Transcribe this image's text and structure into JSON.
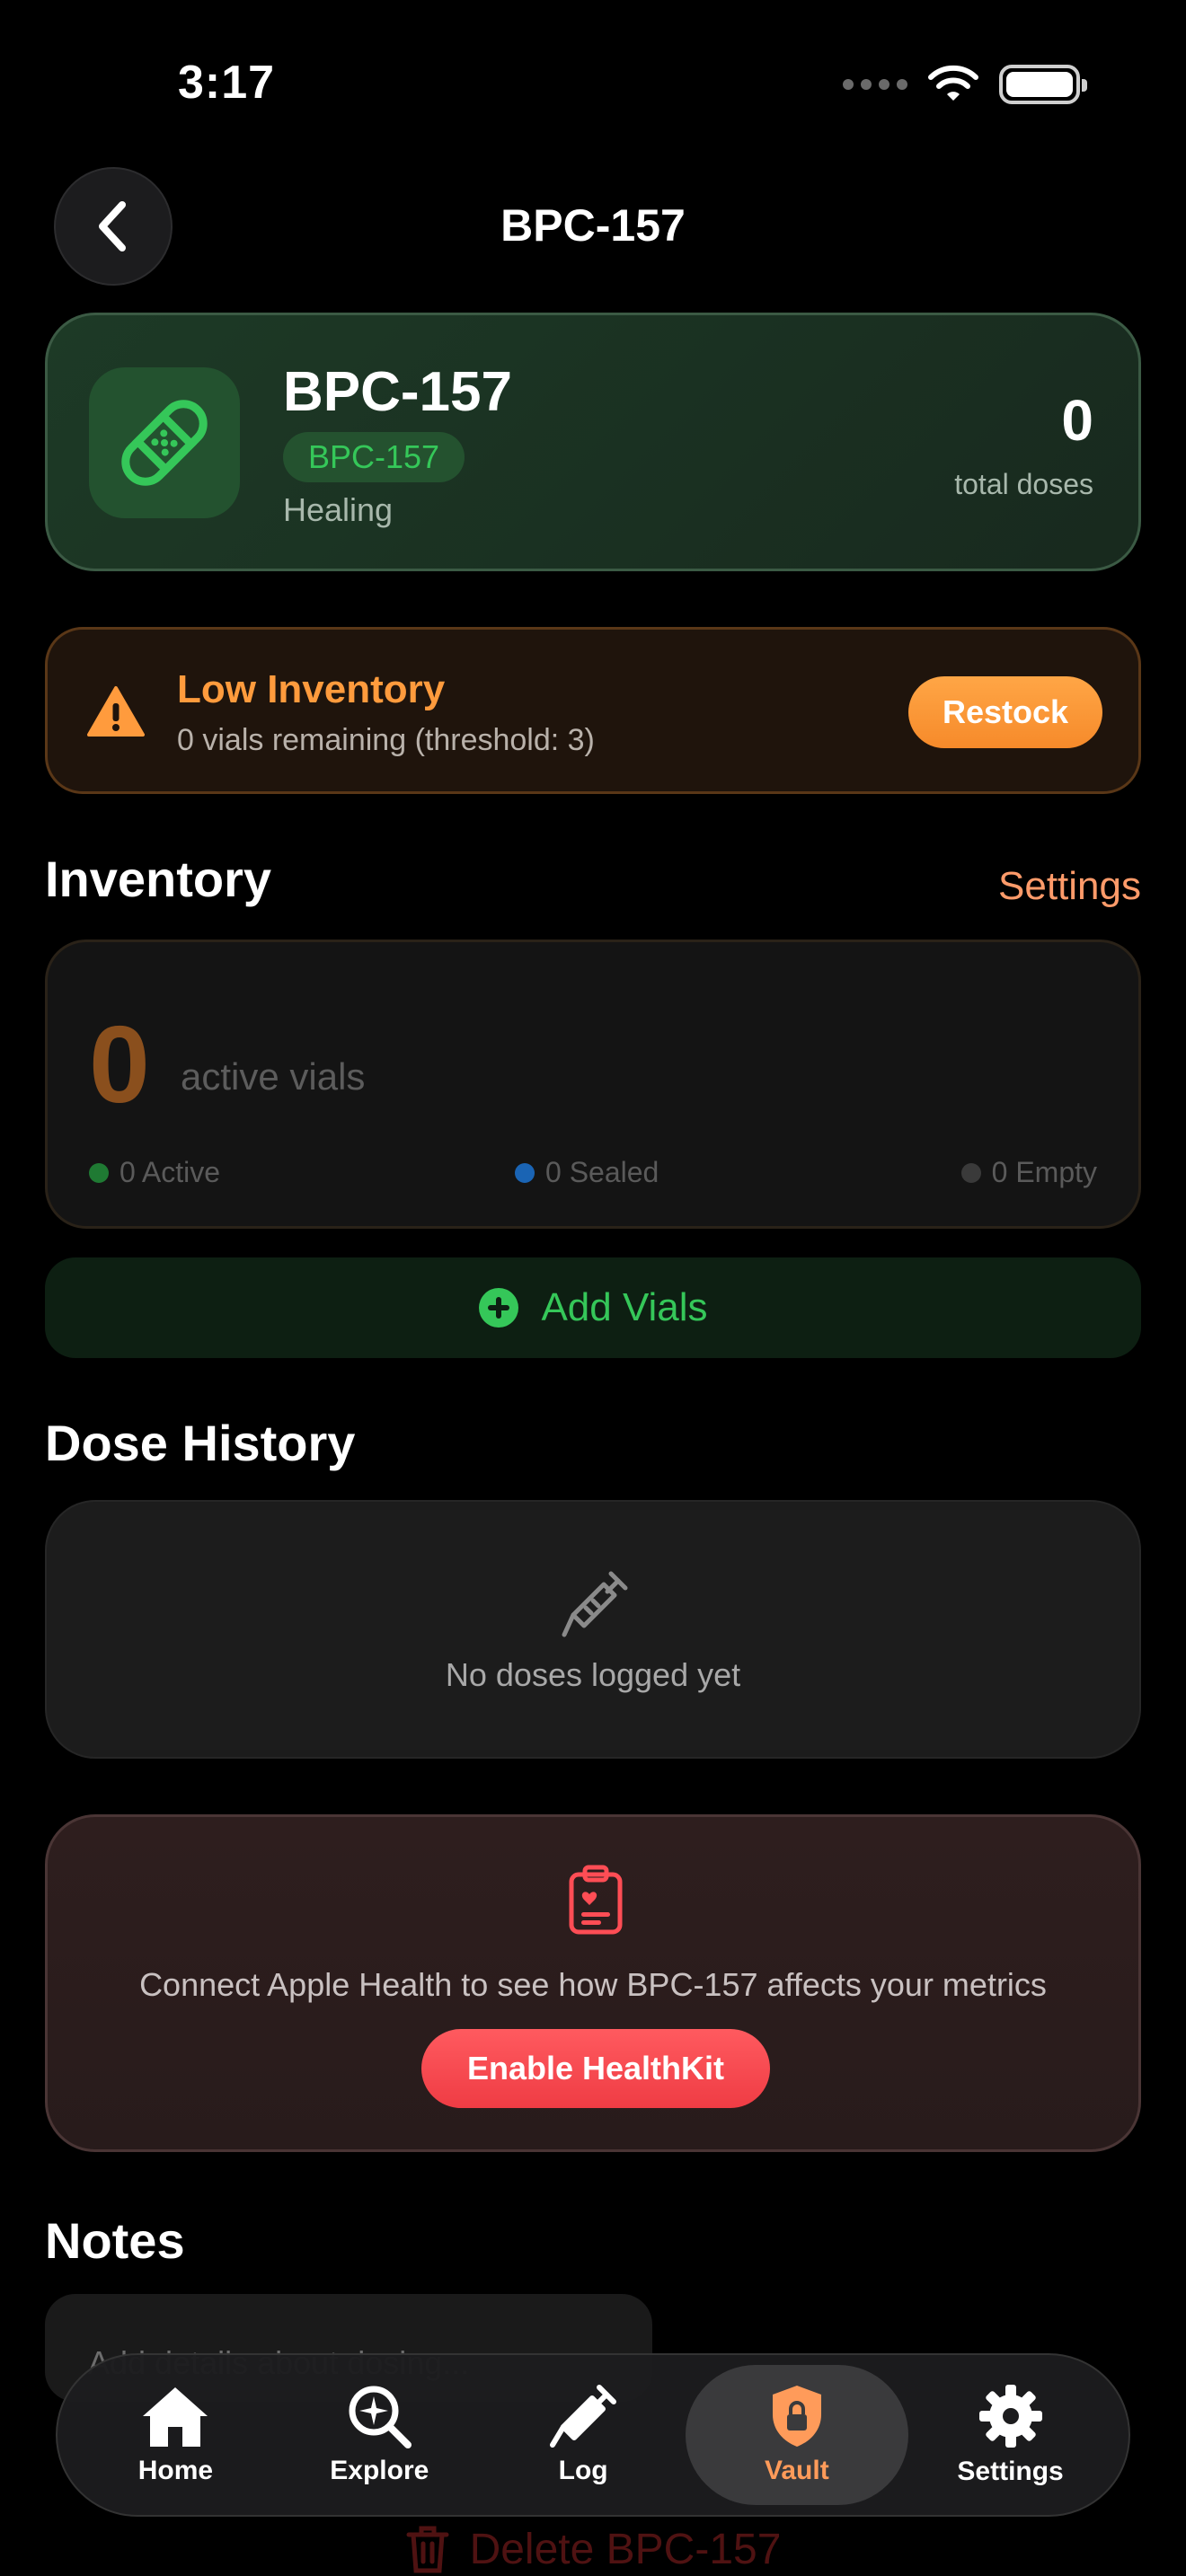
{
  "status_bar": {
    "time": "3:17"
  },
  "nav": {
    "title": "BPC-157",
    "back_icon": "chevron-left-icon"
  },
  "compound": {
    "name": "BPC-157",
    "tag": "BPC-157",
    "category": "Healing",
    "total_doses": "0",
    "total_doses_label": "total doses",
    "icon": "bandage-icon",
    "accent_color": "#35c759"
  },
  "alert": {
    "title": "Low Inventory",
    "subtitle": "0 vials remaining (threshold: 3)",
    "button": "Restock",
    "color": "#ff9b3d"
  },
  "inventory": {
    "title": "Inventory",
    "settings_link": "Settings",
    "count": "0",
    "count_label": "active vials",
    "legend": [
      {
        "label": "0 Active",
        "color": "#1f7a33"
      },
      {
        "label": "0 Sealed",
        "color": "#1a64b4"
      },
      {
        "label": "0 Empty",
        "color": "#3a3a3a"
      }
    ],
    "add_button": "Add Vials"
  },
  "dose_history": {
    "title": "Dose History",
    "empty_text": "No doses logged yet",
    "icon": "syringe-icon"
  },
  "health": {
    "text": "Connect Apple Health to see how BPC-157 affects your metrics",
    "button": "Enable HealthKit",
    "icon": "clipboard-heart-icon",
    "color": "#ff4d55"
  },
  "notes": {
    "title": "Notes",
    "placeholder": "Add details about dosing..."
  },
  "delete": {
    "label": "Delete BPC-157"
  },
  "tabs": [
    {
      "label": "Home",
      "icon": "house-icon",
      "active": false
    },
    {
      "label": "Explore",
      "icon": "explore-icon",
      "active": false
    },
    {
      "label": "Log",
      "icon": "syringe-icon",
      "active": false
    },
    {
      "label": "Vault",
      "icon": "lock-shield-icon",
      "active": true
    },
    {
      "label": "Settings",
      "icon": "gear-icon",
      "active": false
    }
  ]
}
